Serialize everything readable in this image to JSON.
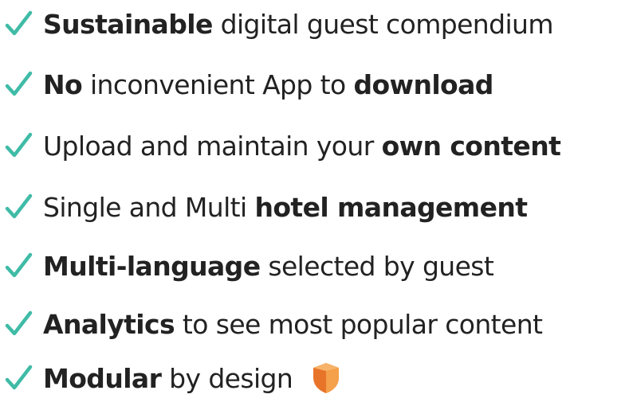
{
  "colors": {
    "check": "#3fbba6",
    "text": "#222222",
    "shield_light": "#f5a04a",
    "shield_dark": "#e8742a"
  },
  "icons": {
    "bullet": "check-icon",
    "badge": "shield-icon"
  },
  "features": [
    {
      "bold_1": "Sustainable",
      "text_1": " digital guest compendium",
      "bold_2": "",
      "text_2": ""
    },
    {
      "bold_1": "No",
      "text_1": " inconvenient App to ",
      "bold_2": "download",
      "text_2": ""
    },
    {
      "bold_1": "",
      "text_1": "Upload and maintain your ",
      "bold_2": "own content",
      "text_2": ""
    },
    {
      "bold_1": "",
      "text_1": "Single and Multi ",
      "bold_2": "hotel management",
      "text_2": ""
    },
    {
      "bold_1": "Multi-language",
      "text_1": " selected by guest",
      "bold_2": "",
      "text_2": ""
    },
    {
      "bold_1": "Analytics",
      "text_1": " to see most popular content",
      "bold_2": "",
      "text_2": ""
    },
    {
      "bold_1": "Modular",
      "text_1": " by design",
      "bold_2": "",
      "text_2": ""
    }
  ]
}
